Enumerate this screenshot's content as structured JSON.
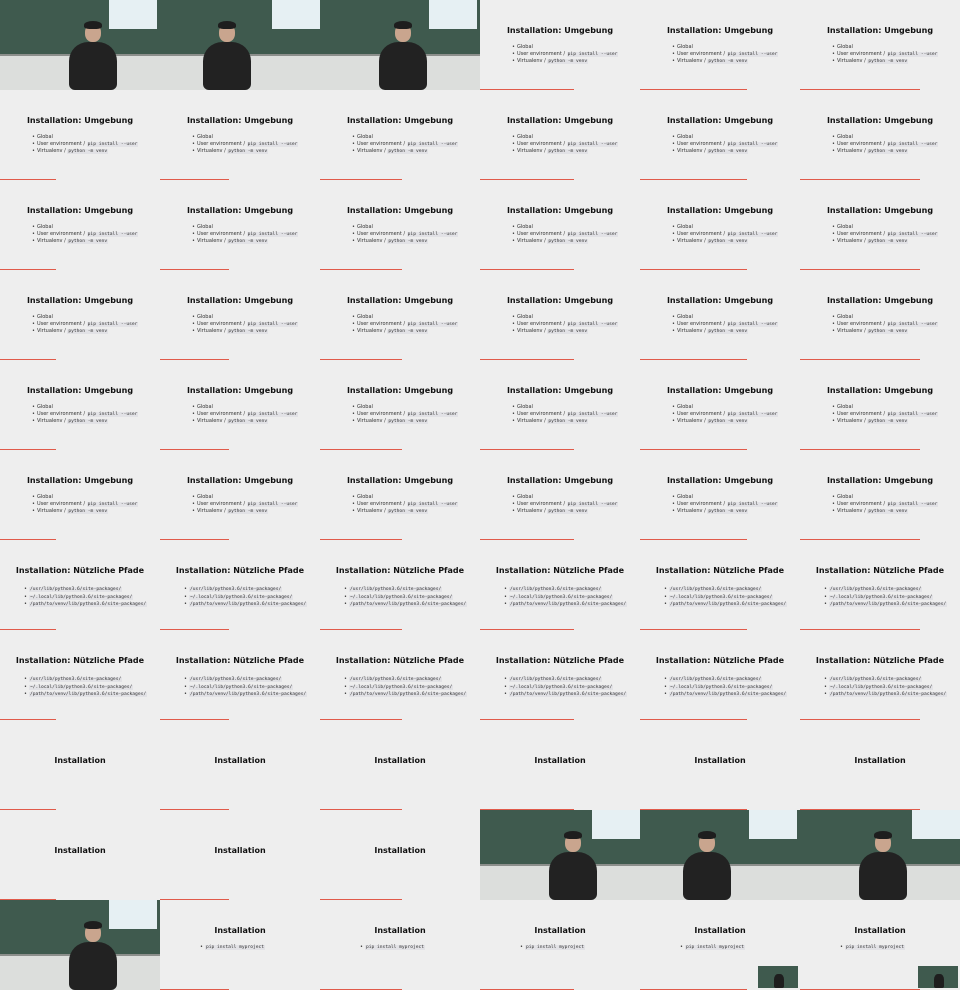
{
  "colors": {
    "slide_bg": "#eeeeee",
    "accent_bar": "#e05a4a",
    "title": "#111111",
    "board": "#3f5a4e"
  },
  "slides": {
    "umgebung": {
      "title": "Installation: Umgebung",
      "items": [
        {
          "text": "Global",
          "code": ""
        },
        {
          "text": "User environment / ",
          "code": "pip install --user"
        },
        {
          "text": "Virtualenv / ",
          "code": "python -m venv"
        }
      ]
    },
    "pfade": {
      "title": "Installation: Nützliche Pfade",
      "items": [
        {
          "text": "",
          "code": "/usr/lib/python3.6/site-packages/"
        },
        {
          "text": "",
          "code": "~/.local/lib/python3.6/site-packages/"
        },
        {
          "text": "",
          "code": "/path/to/venv/lib/python3.6/site-packages/"
        }
      ]
    },
    "install": {
      "title": "Installation",
      "items": []
    },
    "install_pip": {
      "title": "Installation",
      "items": [
        {
          "text": "",
          "code": "pip install myproject"
        }
      ]
    }
  },
  "tiles": [
    "cam",
    "cam",
    "cam",
    "umgebung",
    "umgebung",
    "umgebung",
    "umgebung",
    "umgebung",
    "umgebung",
    "umgebung",
    "umgebung",
    "umgebung",
    "umgebung",
    "umgebung",
    "umgebung",
    "umgebung",
    "umgebung",
    "umgebung",
    "umgebung",
    "umgebung",
    "umgebung",
    "umgebung",
    "umgebung",
    "umgebung",
    "umgebung",
    "umgebung",
    "umgebung",
    "umgebung",
    "umgebung",
    "umgebung",
    "umgebung",
    "umgebung",
    "umgebung",
    "umgebung",
    "umgebung",
    "umgebung",
    "pfade",
    "pfade",
    "pfade",
    "pfade",
    "pfade",
    "pfade",
    "pfade",
    "pfade",
    "pfade",
    "pfade",
    "pfade",
    "pfade",
    "install",
    "install",
    "install",
    "install",
    "install",
    "install",
    "install",
    "install",
    "install",
    "cam",
    "cam",
    "cam",
    "cam",
    "install_pip",
    "install_pip",
    "install_pip",
    "install_pip:pip",
    "install_pip:pip"
  ]
}
